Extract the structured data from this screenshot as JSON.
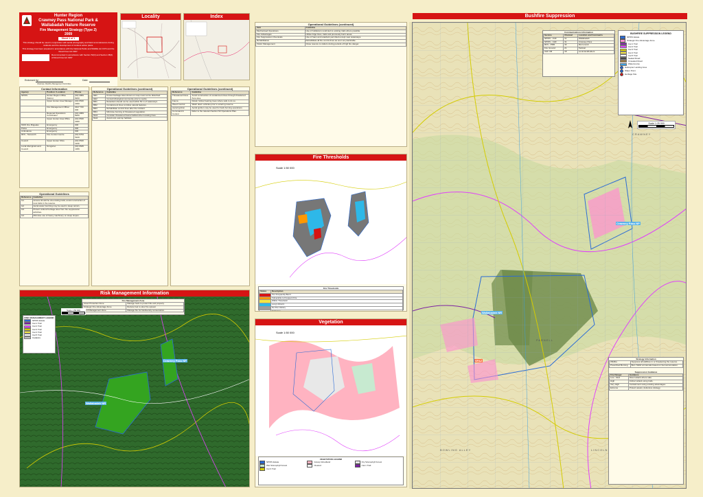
{
  "title_block": {
    "line1": "Hunter Region",
    "line2": "Crawney Pass National Park &",
    "line3": "Wallabadah Nature Reserve",
    "line4": "Fire Management Strategy (Type 2)",
    "year": "2009",
    "sheet": "Sheet 1 of 1",
    "disclaimer": "This strategy should be used in conjunction with aerial photography and field reconnaissance during incidents and the development of incident action plans.",
    "note": "This strategy has been prepared in accordance with the National Parks and Wildlife Act 1974 and the Rural Fires Act 1997.",
    "approval_text": "Recommended in accordance with Section 52(3) and Section 38(4) of Rural Fires Act 1997",
    "endorsed_label": "Endorsed by:",
    "date_label": "Date:",
    "signature_caption": "Chairman, Bushfire Management Committee"
  },
  "panels": {
    "locality": "Locality",
    "index": "Index",
    "bushfire": "Bushfire Suppression",
    "risk": "Risk Management Information",
    "fire_thresholds": "Fire Thresholds",
    "vegetation": "Vegetation"
  },
  "contact": {
    "title": "Contact Information",
    "headers": [
      "Agency",
      "Position / Location",
      "Phone"
    ],
    "rows": [
      [
        "NPWS",
        "Hunter Region Office (Metro)",
        "(02) 4984 8200"
      ],
      [
        "",
        "Upper Hunter Area Manager",
        "(02) 6540 2300"
      ],
      [
        "",
        "Fire Management Officer",
        "0427 700 000"
      ],
      [
        "",
        "Regional Operations Coordinator",
        "(02) 4984 8200"
      ],
      [
        "",
        "Upper Hunter Area Office",
        "(02) 6540 2300"
      ],
      [
        "NSW Fire Brigades",
        "Emergency",
        "000"
      ],
      [
        "Police",
        "Emergency",
        "000"
      ],
      [
        "Ambulance",
        "Emergency",
        "000"
      ],
      [
        "RFS - Tamworth",
        "Fire Control Centre",
        "(02) 6764 5100"
      ],
      [
        "Council",
        "Upper Hunter Shire",
        "(02) 6540 1100"
      ],
      [
        "Local Aboriginal Land Council",
        "Nungaroo",
        "(02) 6545 1366"
      ]
    ]
  },
  "op_guidelines_1": {
    "title": "Operational Guidelines",
    "headers": [
      "Reference",
      "Guideline"
    ],
    "rows": [
      [
        "G1",
        "Access should be via existing trails; avoid construction of new trails in the reserve."
      ],
      [
        "G2",
        "Aerial water bombing may be used in steep terrain."
      ],
      [
        "G3",
        "Protect cultural heritage sites from fire suppression activities."
      ],
      [
        "G4",
        "Minimise use of heavy machinery on steep slopes."
      ]
    ]
  },
  "op_guidelines_2": {
    "title": "Operational Guidelines (continued)",
    "headers": [
      "Reference",
      "Guideline"
    ],
    "rows": [
      [
        "HE1",
        "Known heritage sites shown on map must not be disturbed."
      ],
      [
        "HE2",
        "Consult Aboriginal community prior to works."
      ],
      [
        "BR1",
        "Retardant should not be used within 50 m of waterways."
      ],
      [
        "BR2",
        "Containment lines to follow natural features."
      ],
      [
        "BR3",
        "Rehabilitate control lines after the incident."
      ],
      [
        "BR4",
        "Minimise burning of threatened vegetation."
      ],
      [
        "MH1",
        "Consider threatened fauna habitat when locating lines."
      ],
      [
        "MH2",
        "Avoid rock outcrop habitats."
      ]
    ]
  },
  "op_guidelines_3": {
    "title": "Operational Guidelines (continued)",
    "headers": [
      "Reference",
      "Guideline"
    ],
    "rows": [
      [
        "Threatened Flora",
        "Avoid construction of containment lines through threatened flora sites."
      ],
      [
        "Fauna",
        "Retain hollow bearing trees where safe to do so."
      ],
      [
        "Weed Control",
        "Wash down vehicles prior to entering reserve."
      ],
      [
        "Aerial Ignition",
        "Aerial ignition may be used for back burning operations."
      ],
      [
        "Command & Control",
        "Refer to the relevant Section 52 Operations Plan."
      ]
    ]
  },
  "strategy_table": {
    "title": "Operational Guidelines (continued)",
    "headers": [
      "Item",
      "Guideline"
    ],
    "rows": [
      [
        "Mechanised Operations",
        "Use of bulldozers restricted to existing trails where possible."
      ],
      [
        "Fire Advantages",
        "Utilise ridge lines, trails and previously burnt areas."
      ],
      [
        "Fire Suppression Chemicals",
        "Use of foam and retardant permitted except near waterways."
      ],
      [
        "Rehabilitation",
        "Rehabilitate all fire control lines as soon as practicable."
      ],
      [
        "Visitor Management",
        "Close reserve to visitors during periods of high fire danger."
      ]
    ]
  },
  "comms": {
    "title": "Communications Information",
    "headers": [
      "Service",
      "Channel",
      "Location and Comments"
    ],
    "rows": [
      [
        "NPWS - VHF",
        "11",
        "Wallabadah"
      ],
      [
        "NPWS - UHF",
        "31",
        "Crawney Pass"
      ],
      [
        "RFS - PMR",
        "33",
        "Murrurundi"
      ],
      [
        "Fire Ground",
        "21",
        "Tactical"
      ],
      [
        "UHF CB",
        "18",
        "Local landholders"
      ]
    ]
  },
  "bushfire_legend": {
    "title": "BUSHFIRE SUPPRESSION LEGEND",
    "items": [
      {
        "label": "NPWS Estate",
        "color": "#2a6bd6",
        "kind": "box"
      },
      {
        "label": "Strategic Fire Advantage Zone",
        "color": "#ff8fd0",
        "kind": "box"
      },
      {
        "label": "Cat 1 Trail",
        "color": "#7b1fa2",
        "kind": "line"
      },
      {
        "label": "Cat 2 Trail",
        "color": "#e040fb",
        "kind": "line"
      },
      {
        "label": "Cat 3 Trail",
        "color": "#d4cc00",
        "kind": "line"
      },
      {
        "label": "Cat 4 Trail",
        "color": "#f5e642",
        "kind": "line"
      },
      {
        "label": "Cat 5 Trail",
        "color": "#ffffff",
        "kind": "line"
      },
      {
        "label": "Sealed Road",
        "color": "#444444",
        "kind": "line"
      },
      {
        "label": "Unsealed Road",
        "color": "#9c7a3c",
        "kind": "line"
      },
      {
        "label": "Watercourse",
        "color": "#3ea0e0",
        "kind": "line"
      },
      {
        "label": "Helicopter Landing Area",
        "color": "#1a5fd0",
        "kind": "dot"
      },
      {
        "label": "Water Point",
        "color": "#1a5fd0",
        "kind": "dot"
      },
      {
        "label": "Heritage Site",
        "color": "#d61414",
        "kind": "dot"
      }
    ]
  },
  "map_labels": {
    "wallabadah": "Wallabadah NR",
    "crawney": "Crawney Pass NP",
    "fire_zone_a": "SFAZ",
    "town1": "CRAWNEY",
    "town2": "PARNELL",
    "town3": "LINCOLN",
    "town4": "BOWLING ALLEY"
  },
  "risk_legend": {
    "title": "RISK MANAGEMENT LEGEND",
    "items": [
      {
        "label": "NPWS Estate",
        "color": "#2a6bd6"
      },
      {
        "label": "Cat 1 Trail",
        "color": "#7b1fa2"
      },
      {
        "label": "Cat 2 Trail",
        "color": "#e040fb"
      },
      {
        "label": "Cat 3 Trail",
        "color": "#d4cc00"
      },
      {
        "label": "Cat 4 Trail",
        "color": "#f5e642"
      },
      {
        "label": "Cat 5 Trail",
        "color": "#ffffff"
      },
      {
        "label": "Cadastre",
        "color": "#bdbdbd"
      }
    ]
  },
  "risk_table": {
    "title": "Fire Management Zone",
    "rows": [
      [
        "Asset Protection Zone",
        "Manage fuels to protect life and property."
      ],
      [
        "Strategic Fire Advantage Zone",
        "Reduce fuel to slow fire spread."
      ],
      [
        "Land Management Zone",
        "Manage fire for biodiversity conservation."
      ]
    ]
  },
  "fire_thresholds_legend": {
    "title": "Fire Thresholds",
    "headers": [
      "Status",
      "Description"
    ],
    "rows": [
      {
        "label": "Too Frequently Burnt",
        "color": "#d61414"
      },
      {
        "label": "Vulnerable to Frequent Fire",
        "color": "#ff9800"
      },
      {
        "label": "Within Threshold",
        "color": "#f5e642"
      },
      {
        "label": "Long Unburnt",
        "color": "#2eb8e8"
      },
      {
        "label": "No Fire History",
        "color": "#9e9e9e"
      },
      {
        "label": "Unknown",
        "color": "#ffffff"
      }
    ]
  },
  "vegetation_legend": {
    "title": "VEGETATION LEGEND",
    "items": [
      {
        "label": "NPWS Estate",
        "color": "#2a6bd6"
      },
      {
        "label": "Grassy Woodland",
        "color": "#ffb3c1"
      },
      {
        "label": "Dry Sclerophyll Forest",
        "color": "#e8e8e8"
      },
      {
        "label": "Wet Sclerophyll Forest",
        "color": "#c7ead0"
      },
      {
        "label": "Cleared",
        "color": "#ffffff"
      },
      {
        "label": "Cat 1 Trail",
        "color": "#7b1fa2"
      },
      {
        "label": "Cat 3 Trail",
        "color": "#d4cc00"
      }
    ]
  },
  "scale": {
    "main": "Scale 1:25 000",
    "risk": "Scale 1:50 000",
    "small": "Scale 1:50 000"
  },
  "right_tables": {
    "title1": "Strategy Information",
    "rows1": [
      [
        "Wildfire",
        "Suppress all wildfires in or threatening the reserve."
      ],
      [
        "Prescribed Burning",
        "Burn SFAZ at intervals based on fuel accumulation."
      ]
    ],
    "title2": "Suppression Guidance",
    "headers2": [
      "Fire Danger",
      "Guidance"
    ],
    "rows2": [
      [
        "Low - Mod",
        "Direct attack where safe."
      ],
      [
        "High",
        "Indirect attack using trails."
      ],
      [
        "Very High",
        "Containment using existing advantages."
      ],
      [
        "Extreme",
        "Protect assets; defensive strategy."
      ]
    ]
  }
}
